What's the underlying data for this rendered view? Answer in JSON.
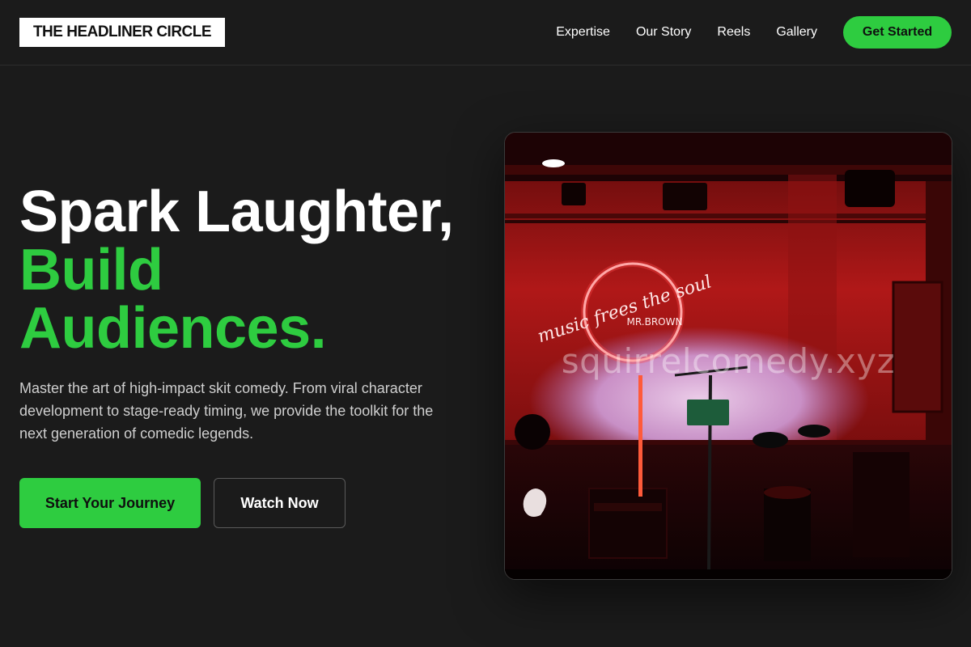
{
  "header": {
    "logo": "THE HEADLINER CIRCLE",
    "nav": [
      {
        "label": "Expertise"
      },
      {
        "label": "Our Story"
      },
      {
        "label": "Reels"
      },
      {
        "label": "Gallery"
      }
    ],
    "cta_label": "Get Started"
  },
  "hero": {
    "headline_line1": "Spark Laughter,",
    "headline_line2": "Build",
    "headline_line3": "Audiences.",
    "description": "Master the art of high-impact skit comedy. From viral character development to stage-ready timing, we provide the toolkit for the next generation of comedic legends.",
    "primary_button": "Start Your Journey",
    "secondary_button": "Watch Now",
    "image": {
      "neon_sign_line1": "music frees the soul",
      "neon_sign_line2": "MR.BROWN",
      "watermark": "squirrelcomedy.xyz"
    }
  },
  "colors": {
    "background": "#1b1b1b",
    "accent": "#2ecc40",
    "text": "#ffffff",
    "muted_text": "#cfcfcf"
  }
}
